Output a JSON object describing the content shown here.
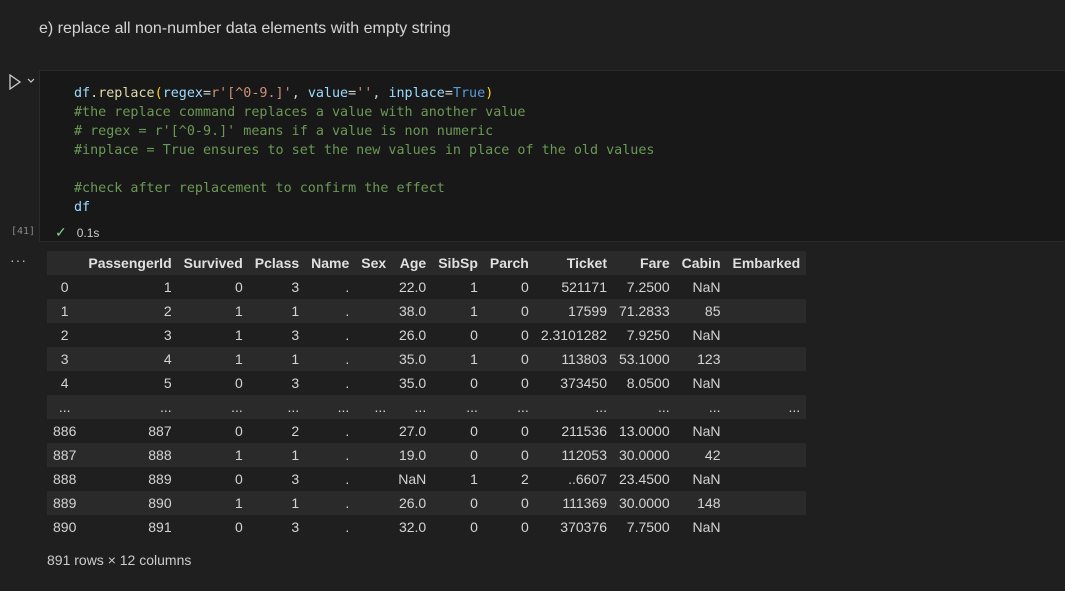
{
  "markdown": {
    "heading": "e) replace all non-number data elements with empty string"
  },
  "cell": {
    "execution_count": "[41]",
    "status_time": "0.1s",
    "code_lines": [
      [
        {
          "t": "df",
          "c": "tk-var"
        },
        {
          "t": ".",
          "c": "tk-op"
        },
        {
          "t": "replace",
          "c": "tk-fn"
        },
        {
          "t": "(",
          "c": "tk-par"
        },
        {
          "t": "regex",
          "c": "tk-var"
        },
        {
          "t": "=",
          "c": "tk-op"
        },
        {
          "t": "r'[^0-9.]'",
          "c": "tk-str"
        },
        {
          "t": ", ",
          "c": "tk-op"
        },
        {
          "t": "value",
          "c": "tk-var"
        },
        {
          "t": "=",
          "c": "tk-op"
        },
        {
          "t": "''",
          "c": "tk-str"
        },
        {
          "t": ", ",
          "c": "tk-op"
        },
        {
          "t": "inplace",
          "c": "tk-var"
        },
        {
          "t": "=",
          "c": "tk-op"
        },
        {
          "t": "True",
          "c": "tk-kw"
        },
        {
          "t": ")",
          "c": "tk-par"
        }
      ],
      [
        {
          "t": "#the replace command replaces a value with another value",
          "c": "tk-cm"
        }
      ],
      [
        {
          "t": "# regex = r'[^0-9.]' means if a value is non numeric",
          "c": "tk-cm"
        }
      ],
      [
        {
          "t": "#inplace = True ensures to set the new values in place of the old values",
          "c": "tk-cm"
        }
      ],
      [],
      [
        {
          "t": "#check after replacement to confirm the effect",
          "c": "tk-cm"
        }
      ],
      [
        {
          "t": "df",
          "c": "tk-var"
        }
      ]
    ]
  },
  "output": {
    "columns": [
      "",
      "PassengerId",
      "Survived",
      "Pclass",
      "Name",
      "Sex",
      "Age",
      "SibSp",
      "Parch",
      "Ticket",
      "Fare",
      "Cabin",
      "Embarked"
    ],
    "rows": [
      [
        "0",
        "1",
        "0",
        "3",
        ".",
        "",
        "22.0",
        "1",
        "0",
        "521171",
        "7.2500",
        "NaN",
        ""
      ],
      [
        "1",
        "2",
        "1",
        "1",
        ".",
        "",
        "38.0",
        "1",
        "0",
        "17599",
        "71.2833",
        "85",
        ""
      ],
      [
        "2",
        "3",
        "1",
        "3",
        ".",
        "",
        "26.0",
        "0",
        "0",
        "2.3101282",
        "7.9250",
        "NaN",
        ""
      ],
      [
        "3",
        "4",
        "1",
        "1",
        ".",
        "",
        "35.0",
        "1",
        "0",
        "113803",
        "53.1000",
        "123",
        ""
      ],
      [
        "4",
        "5",
        "0",
        "3",
        ".",
        "",
        "35.0",
        "0",
        "0",
        "373450",
        "8.0500",
        "NaN",
        ""
      ],
      [
        "...",
        "...",
        "...",
        "...",
        "...",
        "...",
        "...",
        "...",
        "...",
        "...",
        "...",
        "...",
        "..."
      ],
      [
        "886",
        "887",
        "0",
        "2",
        ".",
        "",
        "27.0",
        "0",
        "0",
        "211536",
        "13.0000",
        "NaN",
        ""
      ],
      [
        "887",
        "888",
        "1",
        "1",
        ".",
        "",
        "19.0",
        "0",
        "0",
        "112053",
        "30.0000",
        "42",
        ""
      ],
      [
        "888",
        "889",
        "0",
        "3",
        ".",
        "",
        "NaN",
        "1",
        "2",
        "..6607",
        "23.4500",
        "NaN",
        ""
      ],
      [
        "889",
        "890",
        "1",
        "1",
        ".",
        "",
        "26.0",
        "0",
        "0",
        "111369",
        "30.0000",
        "148",
        ""
      ],
      [
        "890",
        "891",
        "0",
        "3",
        ".",
        "",
        "32.0",
        "0",
        "0",
        "370376",
        "7.7500",
        "NaN",
        ""
      ]
    ],
    "shape_note": "891 rows × 12 columns"
  }
}
